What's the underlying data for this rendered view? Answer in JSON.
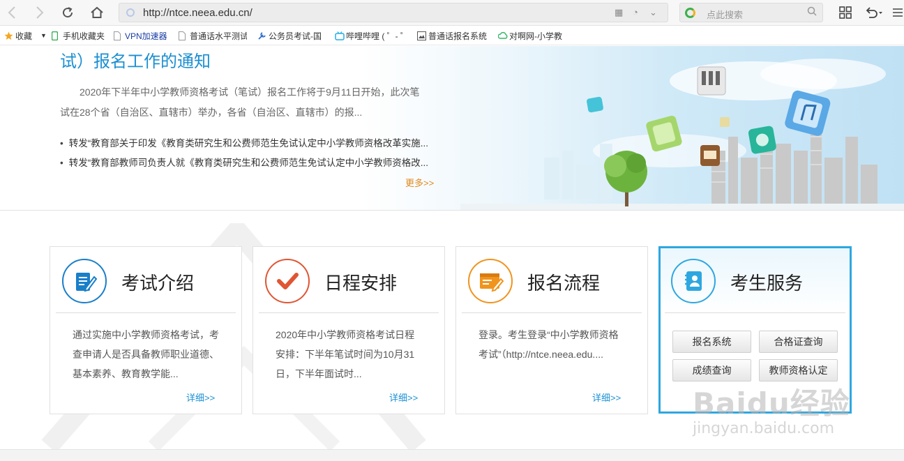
{
  "browser": {
    "url": "http://ntce.neea.edu.cn/",
    "search_placeholder": "点此搜索"
  },
  "bookmarks": [
    {
      "label": "收藏",
      "icon": "star-icon"
    },
    {
      "label": "手机收藏夹",
      "icon": "phone-icon"
    },
    {
      "label": "VPN加速器",
      "icon": "page-icon"
    },
    {
      "label": "普通话水平测试",
      "icon": "page-icon"
    },
    {
      "label": "公务员考试-国",
      "icon": "tool-icon"
    },
    {
      "label": "哔哩哔哩 ( ゜- ゜",
      "icon": "bilibili-icon"
    },
    {
      "label": "普通话报名系统",
      "icon": "image-icon"
    },
    {
      "label": "对啊网-小学教",
      "icon": "cloud-icon"
    }
  ],
  "hero": {
    "title": "试）报名工作的通知",
    "desc_line1": "2020年下半年中小学教师资格考试（笔试）报名工作将于9月11日开始，此次笔",
    "desc_line2": "试在28个省（自治区、直辖市）举办，各省（自治区、直辖市）的报...",
    "news": [
      "转发“教育部关于印发《教育类研究生和公费师范生免试认定中小学教师资格改革实施...",
      "转发“教育部教师司负责人就《教育类研究生和公费师范生免试认定中小学教师资格改..."
    ],
    "more": "更多>>"
  },
  "cards": [
    {
      "title": "考试介绍",
      "lines": [
        "通过实施中小学教师资格考试，考",
        "查申请人是否具备教师职业道德、",
        "基本素养、教育教学能..."
      ],
      "more": "详细>>",
      "color": "#1a7fc9"
    },
    {
      "title": "日程安排",
      "lines": [
        "2020年中小学教师资格考试日程",
        "安排：下半年笔试时间为10月31",
        "日，下半年面试时..."
      ],
      "more": "详细>>",
      "color": "#e05533"
    },
    {
      "title": "报名流程",
      "lines": [
        "登录。考生登录“中小学教师资格",
        "考试”（http://ntce.neea.edu....",
        ""
      ],
      "more": "详细>>",
      "color": "#f0941e"
    },
    {
      "title": "考生服务",
      "buttons": [
        "报名系统",
        "合格证查询",
        "成绩查询",
        "教师资格认定"
      ],
      "color": "#2ea7e0"
    }
  ],
  "watermark": {
    "brand": "Baidu经验",
    "domain": "jingyan.baidu.com"
  }
}
